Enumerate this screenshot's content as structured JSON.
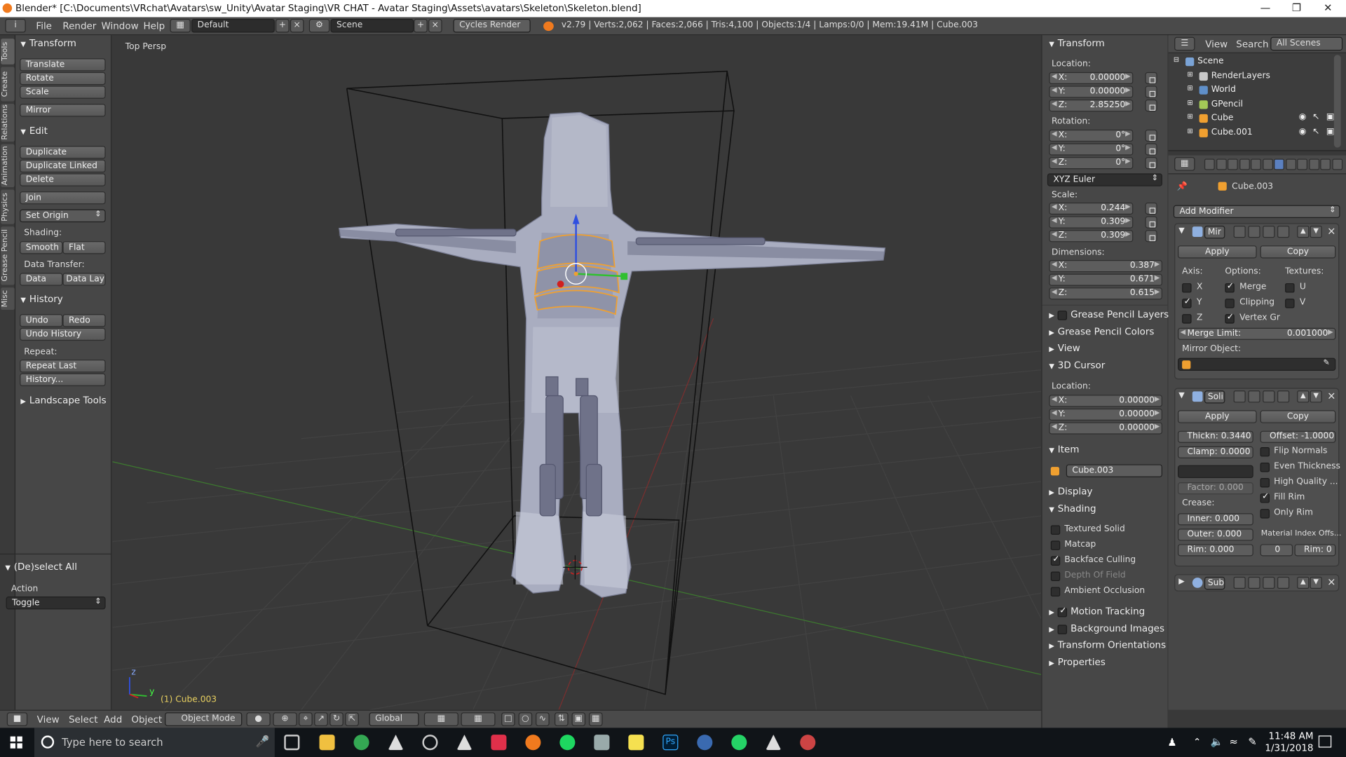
{
  "window": {
    "title": "Blender* [C:\\Documents\\VRchat\\Avatars\\sw_Unity\\Avatar Staging\\VR CHAT - Avatar Staging\\Assets\\avatars\\Skeleton\\Skeleton.blend]"
  },
  "info_header": {
    "menus": [
      "File",
      "Render",
      "Window",
      "Help"
    ],
    "layout": "Default",
    "scene": "Scene",
    "engine": "Cycles Render",
    "stats": "v2.79 | Verts:2,062 | Faces:2,066 | Tris:4,100 | Objects:1/4 | Lamps:0/0 | Mem:19.41M | Cube.003"
  },
  "tool_tabs": [
    "Tools",
    "Create",
    "Relations",
    "Animation",
    "Physics",
    "Grease Pencil",
    "Misc"
  ],
  "tool_shelf": {
    "transform": {
      "title": "Transform",
      "buttons": [
        "Translate",
        "Rotate",
        "Scale",
        "Mirror"
      ]
    },
    "edit": {
      "title": "Edit",
      "buttons": [
        "Duplicate",
        "Duplicate Linked",
        "Delete",
        "Join"
      ],
      "set_origin": "Set Origin",
      "shading_label": "Shading:",
      "smooth": "Smooth",
      "flat": "Flat",
      "data_transfer_label": "Data Transfer:",
      "data": "Data",
      "data_layo": "Data Layo"
    },
    "history": {
      "title": "History",
      "undo": "Undo",
      "redo": "Redo",
      "undo_history": "Undo History",
      "repeat_label": "Repeat:",
      "repeat_last": "Repeat Last",
      "history_btn": "History..."
    },
    "landscape": {
      "title": "Landscape Tools"
    },
    "operator": {
      "title": "(De)select All",
      "action_label": "Action",
      "action_value": "Toggle"
    }
  },
  "viewport": {
    "view_label": "Top Persp",
    "object_label": "(1) Cube.003",
    "axis_x": "y",
    "axis_z": "z"
  },
  "bottom_header": {
    "menus": [
      "View",
      "Select",
      "Add",
      "Object"
    ],
    "mode": "Object Mode",
    "orientation": "Global"
  },
  "n_panel": {
    "transform_title": "Transform",
    "location_label": "Location:",
    "location": [
      {
        "k": "X:",
        "v": "0.00000"
      },
      {
        "k": "Y:",
        "v": "0.00000"
      },
      {
        "k": "Z:",
        "v": "2.85250"
      }
    ],
    "rotation_label": "Rotation:",
    "rotation": [
      {
        "k": "X:",
        "v": "0°"
      },
      {
        "k": "Y:",
        "v": "0°"
      },
      {
        "k": "Z:",
        "v": "0°"
      }
    ],
    "rotation_mode": "XYZ Euler",
    "scale_label": "Scale:",
    "scale": [
      {
        "k": "X:",
        "v": "0.244"
      },
      {
        "k": "Y:",
        "v": "0.309"
      },
      {
        "k": "Z:",
        "v": "0.309"
      }
    ],
    "dimensions_label": "Dimensions:",
    "dimensions": [
      {
        "k": "X:",
        "v": "0.387"
      },
      {
        "k": "Y:",
        "v": "0.671"
      },
      {
        "k": "Z:",
        "v": "0.615"
      }
    ],
    "grease_pencil_layers": "Grease Pencil Layers",
    "grease_pencil_colors": "Grease Pencil Colors",
    "view": "View",
    "cursor_title": "3D Cursor",
    "cursor_location_label": "Location:",
    "cursor": [
      {
        "k": "X:",
        "v": "0.00000"
      },
      {
        "k": "Y:",
        "v": "0.00000"
      },
      {
        "k": "Z:",
        "v": "0.00000"
      }
    ],
    "item_title": "Item",
    "item_name": "Cube.003",
    "display": "Display",
    "shading_title": "Shading",
    "shading_opts": [
      {
        "label": "Textured Solid",
        "on": false,
        "dim": false
      },
      {
        "label": "Matcap",
        "on": false,
        "dim": false
      },
      {
        "label": "Backface Culling",
        "on": true,
        "dim": false
      },
      {
        "label": "Depth Of Field",
        "on": false,
        "dim": true
      },
      {
        "label": "Ambient Occlusion",
        "on": false,
        "dim": false
      }
    ],
    "motion_tracking": "Motion Tracking",
    "background_images": "Background Images",
    "transform_orientations": "Transform Orientations",
    "properties": "Properties"
  },
  "outliner": {
    "view": "View",
    "search": "Search",
    "all_scenes": "All Scenes",
    "rows": [
      {
        "label": "Scene",
        "indent": 0,
        "color": "#7aa3d6"
      },
      {
        "label": "RenderLayers",
        "indent": 1,
        "color": "#c9c9c9"
      },
      {
        "label": "World",
        "indent": 1,
        "color": "#5f8fc9"
      },
      {
        "label": "GPencil",
        "indent": 1,
        "color": "#a3c957"
      },
      {
        "label": "Cube",
        "indent": 1,
        "color": "#f0a030"
      },
      {
        "label": "Cube.001",
        "indent": 1,
        "color": "#f0a030"
      }
    ]
  },
  "properties": {
    "object_name": "Cube.003",
    "add_modifier": "Add Modifier",
    "mirror": {
      "name": "Mir",
      "apply": "Apply",
      "copy": "Copy",
      "axis_label": "Axis:",
      "options_label": "Options:",
      "textures_label": "Textures:",
      "axes": [
        {
          "k": "X",
          "on": false
        },
        {
          "k": "Y",
          "on": true
        },
        {
          "k": "Z",
          "on": false
        }
      ],
      "options": [
        {
          "k": "Merge",
          "on": true
        },
        {
          "k": "Clipping",
          "on": false
        },
        {
          "k": "Vertex Gr",
          "on": true
        }
      ],
      "textures": [
        {
          "k": "U",
          "on": false
        },
        {
          "k": "V",
          "on": false
        }
      ],
      "merge_limit_label": "Merge Limit:",
      "merge_limit": "0.001000",
      "mirror_object": "Mirror Object:"
    },
    "solidify": {
      "name": "Soli",
      "apply": "Apply",
      "copy": "Copy",
      "thickness": "Thickn: 0.3440",
      "offset": "Offset: -1.0000",
      "clamp": "Clamp: 0.0000",
      "flip_normals": "Flip Normals",
      "even_thickness": "Even Thickness",
      "high_quality": "High Quality ...",
      "fill_rim": "Fill Rim",
      "only_rim": "Only Rim",
      "factor": "Factor: 0.000",
      "crease_label": "Crease:",
      "inner": "Inner: 0.000",
      "outer": "Outer: 0.000",
      "rim": "Rim: 0.000",
      "mat_index_label": "Material Index Offs...",
      "mat_index": "0",
      "mat_rim": "Rim: 0"
    },
    "subsurf": {
      "name": "Sub"
    }
  },
  "taskbar": {
    "search_placeholder": "Type here to search",
    "time": "11:48 AM",
    "date": "1/31/2018"
  }
}
